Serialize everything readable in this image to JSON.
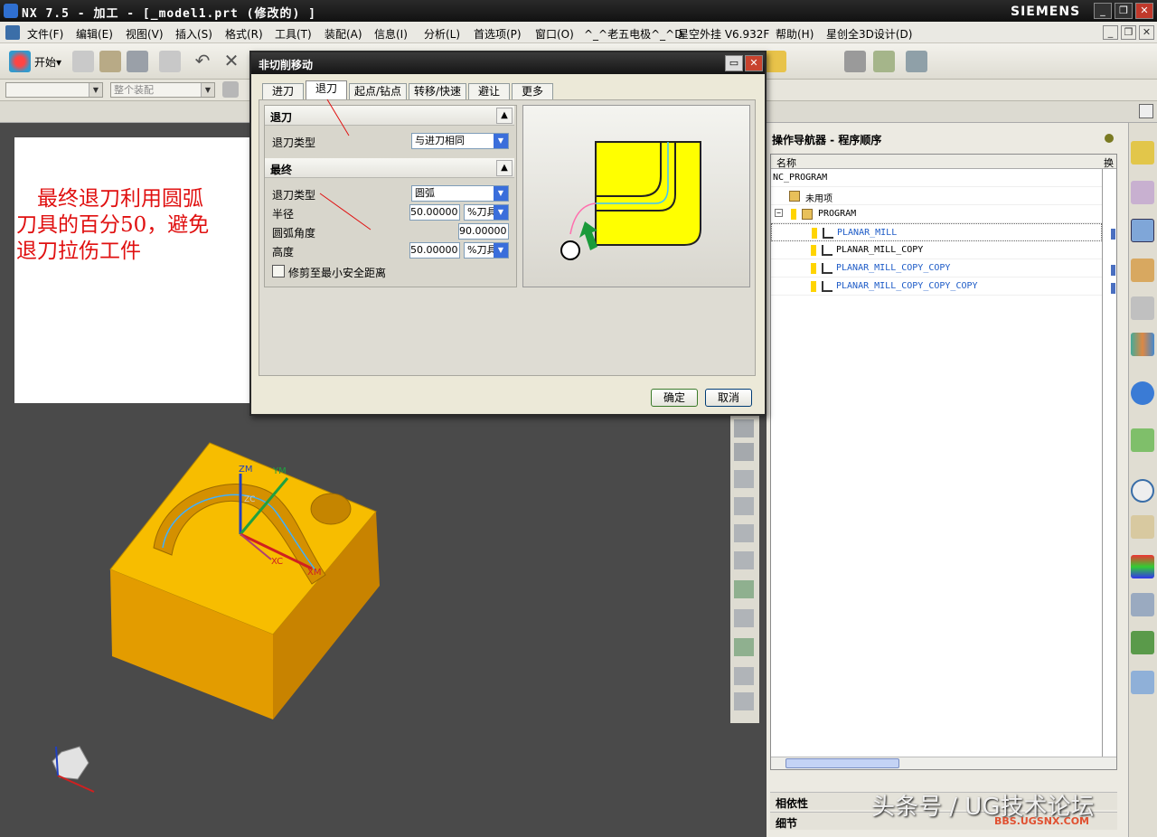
{
  "window": {
    "title": "NX 7.5 - 加工 - [_model1.prt  (修改的) ]",
    "brand": "SIEMENS"
  },
  "menu": [
    "文件(F)",
    "编辑(E)",
    "视图(V)",
    "插入(S)",
    "格式(R)",
    "工具(T)",
    "装配(A)",
    "信息(I)",
    "分析(L)",
    "首选项(P)",
    "窗口(O)",
    "^_^老五电极^_^D",
    "星空外挂 V6.932F",
    "帮助(H)",
    "星创全3D设计(D)"
  ],
  "toolbar": {
    "start_label": "开始▾",
    "assembly_combo": "整个装配"
  },
  "note": {
    "lines": [
      "　最终退刀利用圆弧",
      "刀具的百分50，避免",
      "退刀拉伤工件"
    ]
  },
  "dialog": {
    "title": "非切削移动",
    "tabs": [
      "进刀",
      "退刀",
      "起点/钻点",
      "转移/快速",
      "避让",
      "更多"
    ],
    "active_tab": "退刀",
    "retract_section": {
      "header": "退刀",
      "type_label": "退刀类型",
      "type_value": "与进刀相同"
    },
    "final_section": {
      "header": "最终",
      "type_label": "退刀类型",
      "type_value": "圆弧",
      "radius_label": "半径",
      "radius_value": "50.00000",
      "radius_unit": "%刀具",
      "angle_label": "圆弧角度",
      "angle_value": "90.00000",
      "height_label": "高度",
      "height_value": "50.00000",
      "height_unit": "%刀具",
      "trim_label": "修剪至最小安全距离"
    },
    "ok_label": "确定",
    "cancel_label": "取消"
  },
  "navigator": {
    "title": "操作导航器 - 程序顺序",
    "col_name": "名称",
    "col_change": "换",
    "rows": [
      "NC_PROGRAM",
      "未用项",
      "PROGRAM",
      "PLANAR_MILL",
      "PLANAR_MILL_COPY",
      "PLANAR_MILL_COPY_COPY",
      "PLANAR_MILL_COPY_COPY_COPY"
    ],
    "bottom": [
      "相依性",
      "细节"
    ]
  },
  "axes": {
    "zm": "ZM",
    "ym": "YM",
    "xc": "XC",
    "xm": "XM",
    "zc": "ZC"
  },
  "watermark": "头条号 / UG技术论坛",
  "watermark_sub": "BBS.UGSNX.COM",
  "colors": {
    "part": "#f7bd00",
    "note_text": "#e01010",
    "active_op": "#1d5bc7"
  }
}
